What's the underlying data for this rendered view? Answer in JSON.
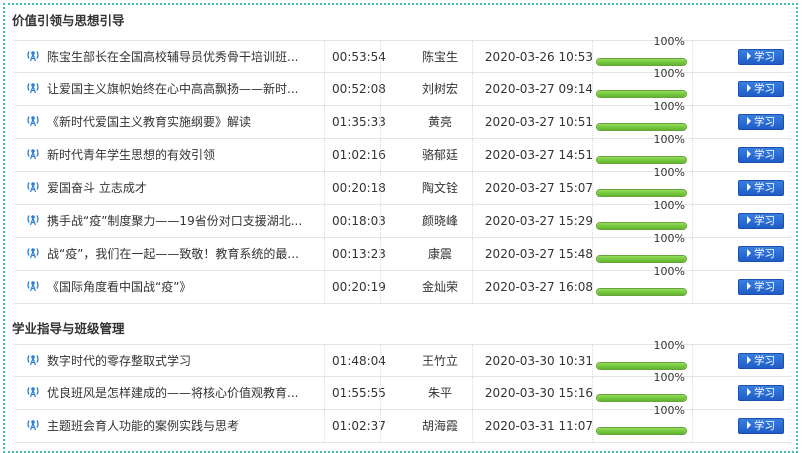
{
  "sections": [
    {
      "title": "价值引领与思想引导",
      "rows": [
        {
          "title": "陈宝生部长在全国高校辅导员优秀骨干培训班...",
          "duration": "00:53:54",
          "lecturer": "陈宝生",
          "time": "2020-03-26 10:53",
          "progress": "100%",
          "action": "学习"
        },
        {
          "title": "让爱国主义旗帜始终在心中高高飘扬——新时...",
          "duration": "00:52:08",
          "lecturer": "刘树宏",
          "time": "2020-03-27 09:14",
          "progress": "100%",
          "action": "学习"
        },
        {
          "title": "《新时代爱国主义教育实施纲要》解读",
          "duration": "01:35:33",
          "lecturer": "黄亮",
          "time": "2020-03-27 10:51",
          "progress": "100%",
          "action": "学习"
        },
        {
          "title": "新时代青年学生思想的有效引领",
          "duration": "01:02:16",
          "lecturer": "骆郁廷",
          "time": "2020-03-27 14:51",
          "progress": "100%",
          "action": "学习"
        },
        {
          "title": "爱国奋斗 立志成才",
          "duration": "00:20:18",
          "lecturer": "陶文铨",
          "time": "2020-03-27 15:07",
          "progress": "100%",
          "action": "学习"
        },
        {
          "title": "携手战“疫”制度聚力——19省份对口支援湖北...",
          "duration": "00:18:03",
          "lecturer": "颜晓峰",
          "time": "2020-03-27 15:29",
          "progress": "100%",
          "action": "学习"
        },
        {
          "title": "战“疫”，我们在一起——致敬！教育系统的最...",
          "duration": "00:13:23",
          "lecturer": "康震",
          "time": "2020-03-27 15:48",
          "progress": "100%",
          "action": "学习"
        },
        {
          "title": "《国际角度看中国战“疫”》",
          "duration": "00:20:19",
          "lecturer": "金灿荣",
          "time": "2020-03-27 16:08",
          "progress": "100%",
          "action": "学习"
        }
      ]
    },
    {
      "title": "学业指导与班级管理",
      "rows": [
        {
          "title": "数字时代的零存整取式学习",
          "duration": "01:48:04",
          "lecturer": "王竹立",
          "time": "2020-03-30 10:31",
          "progress": "100%",
          "action": "学习"
        },
        {
          "title": "优良班风是怎样建成的——将核心价值观教育...",
          "duration": "01:55:55",
          "lecturer": "朱平",
          "time": "2020-03-30 15:16",
          "progress": "100%",
          "action": "学习"
        },
        {
          "title": "主题班会育人功能的案例实践与思考",
          "duration": "01:02:37",
          "lecturer": "胡海霞",
          "time": "2020-03-31 11:07",
          "progress": "100%",
          "action": "学习"
        }
      ]
    }
  ],
  "icon": "broadcast-icon",
  "colors": {
    "accent": "#1f5cc7",
    "progress": "#6fc23a",
    "frame": "#3fbfb0"
  }
}
